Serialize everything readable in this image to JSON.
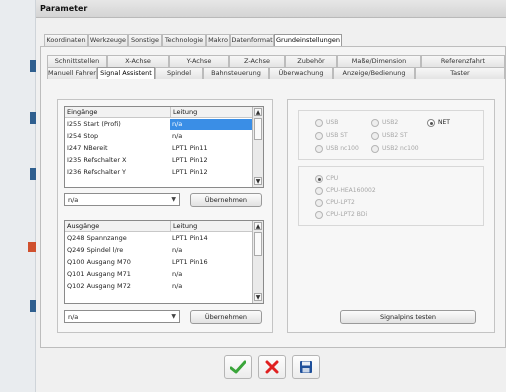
{
  "window": {
    "title": "Parameter"
  },
  "main_tabs": [
    "Koordinaten",
    "Werkzeuge",
    "Sonstige",
    "Technologie",
    "Makro",
    "Datenformat",
    "Grundeinstellungen"
  ],
  "sub_tabs_row1": [
    "Schnittstellen",
    "X-Achse",
    "Y-Achse",
    "Z-Achse",
    "Zubehör",
    "Maße/Dimension",
    "Referenzfahrt"
  ],
  "sub_tabs_row2": [
    "Manuell Fahren",
    "Signal Assistent",
    "Spindel",
    "Bahnsteuerung",
    "Überwachung",
    "Anzeige/Bedienung",
    "Taster"
  ],
  "inputs_table": {
    "headers": [
      "Eingänge",
      "Leitung"
    ],
    "rows": [
      [
        "I255 Start (Profi)",
        "n/a"
      ],
      [
        "I254 Stop",
        "n/a"
      ],
      [
        "I247 NBereit",
        "LPT1 Pin11"
      ],
      [
        "I235 Refschalter X",
        "LPT1 Pin12"
      ],
      [
        "I236 Refschalter Y",
        "LPT1 Pin12"
      ]
    ],
    "combo_value": "n/a",
    "apply_label": "Übernehmen"
  },
  "outputs_table": {
    "headers": [
      "Ausgänge",
      "Leitung"
    ],
    "rows": [
      [
        "Q248 Spannzange",
        "LPT1 Pin14"
      ],
      [
        "Q249 Spindel l/re",
        "n/a"
      ],
      [
        "Q100 Ausgang M70",
        "LPT1 Pin16"
      ],
      [
        "Q101 Ausgang M71",
        "n/a"
      ],
      [
        "Q102 Ausgang M72",
        "n/a"
      ]
    ],
    "combo_value": "n/a",
    "apply_label": "Übernehmen"
  },
  "interface_radios": {
    "row1": [
      "USB",
      "USB2",
      "NET"
    ],
    "row2": [
      "USB ST",
      "USB2 ST"
    ],
    "row3": [
      "USB nc100",
      "USB2 nc100"
    ],
    "selected": "NET"
  },
  "cpu_radios": {
    "options": [
      "CPU",
      "CPU-HEA160002",
      "CPU-LPT2",
      "CPU-LPT2 BDi"
    ],
    "selected": "CPU"
  },
  "test_button_label": "Signalpins testen",
  "colors": {
    "ok": "#3aa53a",
    "cancel": "#e02020",
    "save": "#1e4f9a",
    "selection": "#3a8ee6"
  }
}
